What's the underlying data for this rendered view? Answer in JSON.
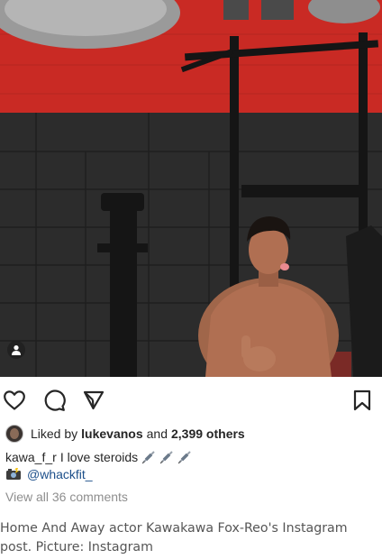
{
  "post": {
    "liked_by_prefix": "Liked by",
    "liked_by_user": "lukevanos",
    "liked_by_joiner": "and",
    "liked_by_others": "2,399 others",
    "caption_user": "kawa_f_r",
    "caption_text": "I love steroids",
    "caption_emoji": "syringe-emoji x3",
    "camera_emoji": "camera-with-flash-emoji",
    "photo_credit_mention": "@whackfit_",
    "view_comments": "View all 36 comments"
  },
  "icons": {
    "like": "heart-icon",
    "comment": "comment-bubble-icon",
    "share": "paper-plane-icon",
    "save": "bookmark-icon",
    "tagged_people": "person-icon"
  },
  "article": {
    "caption": "Home And Away actor Kawakawa Fox-Reo's Instagram post. Picture: Instagram"
  },
  "colors": {
    "wall_red": "#cc2d26",
    "wall_dark": "#2b2b2b",
    "mention_blue": "#1c4f8a",
    "muted_text": "#8e8e8e"
  }
}
